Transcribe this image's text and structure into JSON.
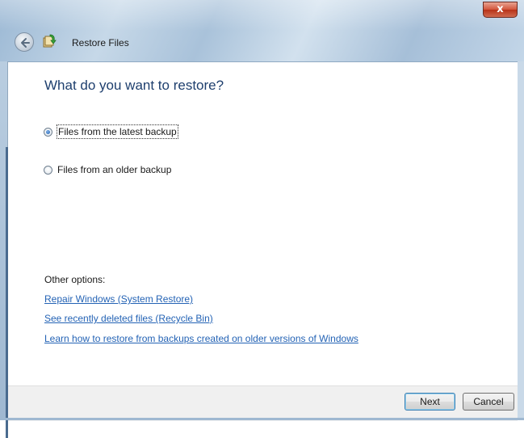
{
  "window": {
    "title": "Restore Files",
    "close_glyph": "x"
  },
  "icons": {
    "back": "back-arrow-icon",
    "app": "restore-files-icon"
  },
  "main": {
    "heading": "What do you want to restore?",
    "options": [
      {
        "label": "Files from the latest backup",
        "selected": true
      },
      {
        "label": "Files from an older backup",
        "selected": false
      }
    ],
    "other_options_label": "Other options:",
    "links": [
      "Repair Windows (System Restore)",
      "See recently deleted files (Recycle Bin)",
      "Learn how to restore from backups created on older versions of Windows"
    ]
  },
  "footer": {
    "next_label": "Next",
    "cancel_label": "Cancel"
  },
  "colors": {
    "heading": "#1e3f6e",
    "link": "#2463b5",
    "radio_selected": "#1f5fb0",
    "close_button": "#c9432a"
  }
}
